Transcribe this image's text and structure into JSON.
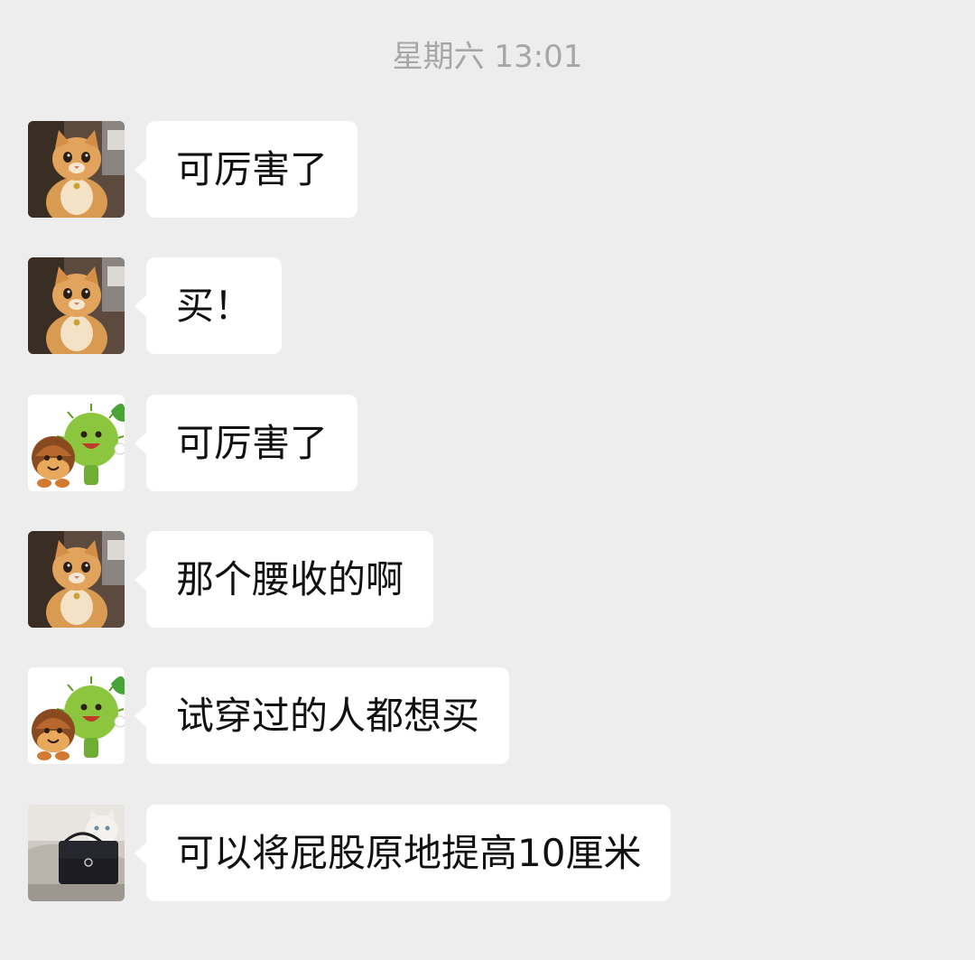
{
  "timestamp": "星期六 13:01",
  "messages": [
    {
      "avatar": "cat-avatar",
      "text": "可厉害了"
    },
    {
      "avatar": "cat-avatar",
      "text": "买！"
    },
    {
      "avatar": "chestnut-cartoon-avatar",
      "text": "可厉害了"
    },
    {
      "avatar": "cat-avatar",
      "text": "那个腰收的啊"
    },
    {
      "avatar": "chestnut-cartoon-avatar",
      "text": "试穿过的人都想买"
    },
    {
      "avatar": "cat-with-bag-avatar",
      "text": "可以将屁股原地提高10厘米"
    }
  ],
  "colors": {
    "background": "#ededed",
    "bubble": "#ffffff",
    "timestamp": "#a6a6a6",
    "text": "#111111"
  }
}
